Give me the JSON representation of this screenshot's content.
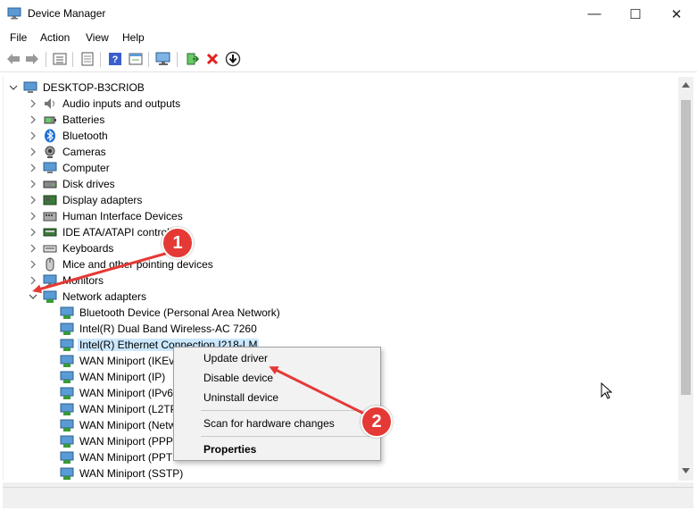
{
  "window": {
    "title": "Device Manager",
    "minimize_glyph": "—",
    "maximize_glyph": "☐",
    "close_glyph": "✕"
  },
  "menubar": {
    "items": [
      "File",
      "Action",
      "View",
      "Help"
    ]
  },
  "toolbar": {
    "icons": [
      "back-arrow-icon",
      "forward-arrow-icon",
      "properties-list-icon",
      "console-tree-icon",
      "help-icon",
      "refresh-view-icon",
      "scan-hardware-icon",
      "enable-device-icon",
      "uninstall-x-icon",
      "update-driver-down-icon"
    ]
  },
  "tree": {
    "root": "DESKTOP-B3CRIOB",
    "categories": [
      {
        "label": "Audio inputs and outputs",
        "icon": "speaker-icon",
        "expanded": false
      },
      {
        "label": "Batteries",
        "icon": "battery-icon",
        "expanded": false
      },
      {
        "label": "Bluetooth",
        "icon": "bluetooth-icon",
        "expanded": false
      },
      {
        "label": "Cameras",
        "icon": "camera-icon",
        "expanded": false
      },
      {
        "label": "Computer",
        "icon": "computer-icon",
        "expanded": false
      },
      {
        "label": "Disk drives",
        "icon": "disk-drive-icon",
        "expanded": false
      },
      {
        "label": "Display adapters",
        "icon": "display-adapter-icon",
        "expanded": false
      },
      {
        "label": "Human Interface Devices",
        "icon": "hid-icon",
        "expanded": false
      },
      {
        "label": "IDE ATA/ATAPI controll",
        "icon": "ide-controller-icon",
        "expanded": false
      },
      {
        "label": "Keyboards",
        "icon": "keyboard-icon",
        "expanded": false
      },
      {
        "label": "Mice and other pointing devices",
        "icon": "mouse-icon",
        "expanded": false
      },
      {
        "label": "Monitors",
        "icon": "monitor-icon",
        "expanded": false
      },
      {
        "label": "Network adapters",
        "icon": "network-adapter-icon",
        "expanded": true
      }
    ],
    "network_children": [
      {
        "label": "Bluetooth Device (Personal Area Network)",
        "selected": false
      },
      {
        "label": "Intel(R) Dual Band Wireless-AC 7260",
        "selected": false
      },
      {
        "label": "Intel(R) Ethernet Connection I218-LM",
        "selected": true
      },
      {
        "label": "WAN Miniport (IKEv",
        "selected": false
      },
      {
        "label": "WAN Miniport (IP)",
        "selected": false
      },
      {
        "label": "WAN Miniport (IPv6",
        "selected": false
      },
      {
        "label": "WAN Miniport (L2TP",
        "selected": false
      },
      {
        "label": "WAN Miniport (Netw",
        "selected": false
      },
      {
        "label": "WAN Miniport (PPP",
        "selected": false
      },
      {
        "label": "WAN Miniport (PPT",
        "selected": false
      },
      {
        "label": "WAN Miniport (SSTP)",
        "selected": false
      }
    ]
  },
  "context_menu": {
    "items": [
      "Update driver",
      "Disable device",
      "Uninstall device",
      "Scan for hardware changes",
      "Properties"
    ]
  },
  "annotations": {
    "callout_1": "1",
    "callout_2": "2",
    "color": "#e53935"
  }
}
